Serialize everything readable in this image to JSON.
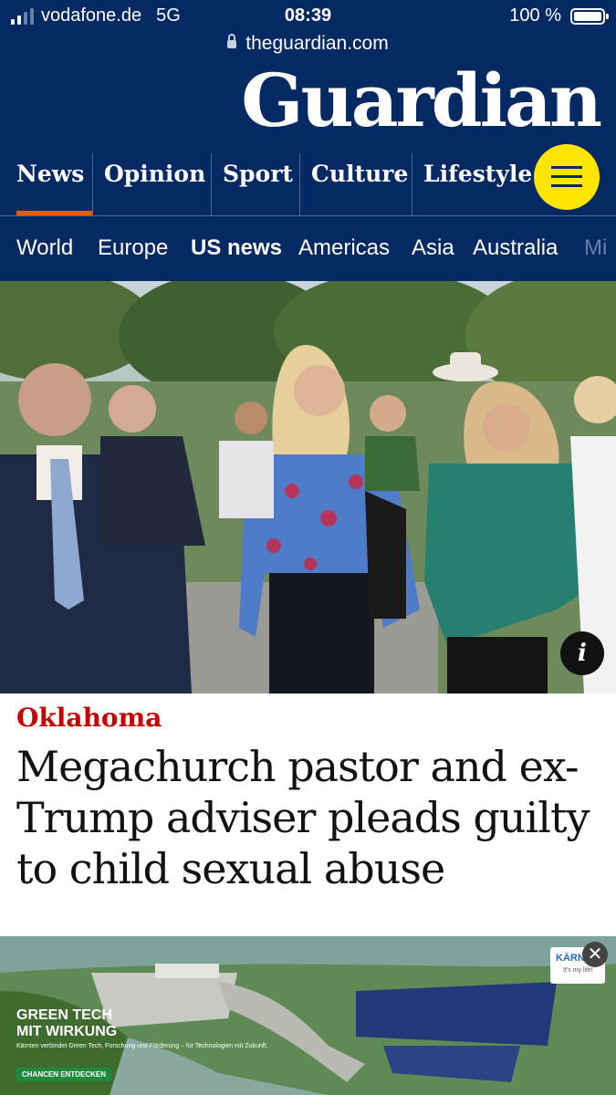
{
  "status_bar": {
    "carrier": "vodafone.de",
    "network": "5G",
    "time": "08:39",
    "battery": "100 %"
  },
  "browser": {
    "url": "theguardian.com"
  },
  "brand": {
    "logo": "Guardian"
  },
  "pillars": [
    {
      "label": "News",
      "active": true
    },
    {
      "label": "Opinion"
    },
    {
      "label": "Sport"
    },
    {
      "label": "Culture"
    },
    {
      "label": "Lifestyle"
    }
  ],
  "subnav": [
    "World",
    "Europe",
    "US news",
    "Americas",
    "Asia",
    "Australia",
    "Mi"
  ],
  "subnav_active": "US news",
  "article": {
    "kicker": "Oklahoma",
    "headline": "Megachurch pastor and ex-Trump adviser pleads guilty to child sexual abuse",
    "info_icon": "i"
  },
  "ad": {
    "title_line1": "GREEN TECH",
    "title_line2": "MIT WIRKUNG",
    "subtitle": "Kärnten verbindet Green Tech, Forschung und Förderung – für Technologien mit Zukunft.",
    "cta": "CHANCEN ENTDECKEN",
    "logo_text": "KÄRNTEN",
    "logo_tagline": "It's my life!",
    "close": "✕"
  },
  "colors": {
    "header_bg": "#052962",
    "kicker": "#c70000",
    "menu_button": "#ffe500",
    "active_underline": "#e05e00"
  },
  "icons": [
    "signal-icon",
    "lock-icon",
    "battery-icon",
    "menu-icon",
    "info-icon",
    "close-icon"
  ]
}
